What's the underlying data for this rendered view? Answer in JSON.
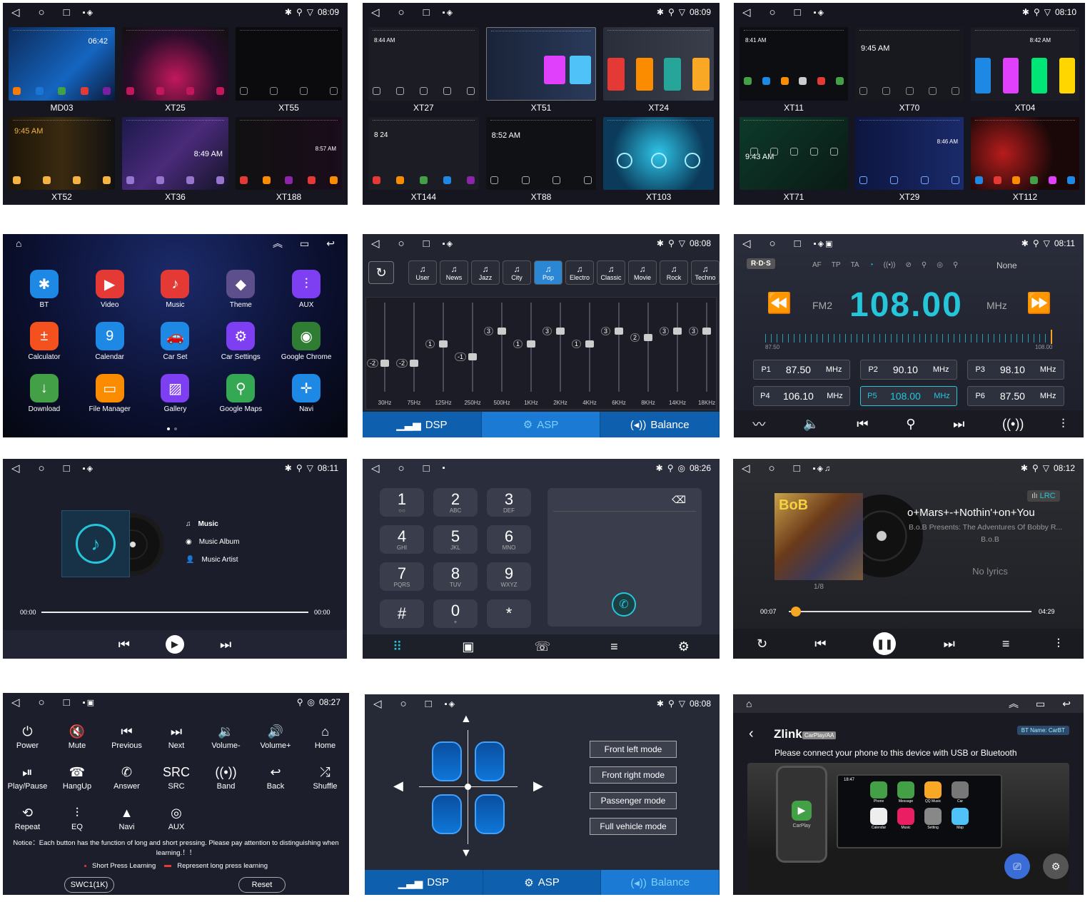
{
  "status": {
    "time_p1": "08:09",
    "time_p2": "08:09",
    "time_p3": "08:10",
    "time_p5": "08:08",
    "time_p6": "08:11",
    "time_p7": "08:11",
    "time_p8": "08:26",
    "time_p9": "08:12",
    "time_p10": "08:27",
    "time_p11": "08:08"
  },
  "themes1": [
    "MD03",
    "XT25",
    "XT55",
    "XT52",
    "XT36",
    "XT188"
  ],
  "themes2": [
    "XT27",
    "XT51",
    "XT24",
    "XT144",
    "XT88",
    "XT103"
  ],
  "themes3": [
    "XT11",
    "XT70",
    "XT04",
    "XT71",
    "XT29",
    "XT112"
  ],
  "theme_clock": {
    "md03": "06:42",
    "xt52": "9:45 AM",
    "xt36": "8:49 AM",
    "xt188": "8:57 AM",
    "xt27": "8:44 AM",
    "xt144": "8 24",
    "xt88": "8:52 AM",
    "xt11": "8:41 AM",
    "xt70": "9:45 AM",
    "xt04": "8:42 AM",
    "xt71": "9:43 AM",
    "xt29": "8:46 AM"
  },
  "launcher": {
    "apps": [
      {
        "label": "BT",
        "icon": "bluetooth-icon",
        "color": "#1e88e5",
        "glyph": "✱"
      },
      {
        "label": "Video",
        "icon": "video-icon",
        "color": "#e53935",
        "glyph": "▶"
      },
      {
        "label": "Music",
        "icon": "music-icon",
        "color": "#e53935",
        "glyph": "♪"
      },
      {
        "label": "Theme",
        "icon": "theme-icon",
        "color": "#5d4e8c",
        "glyph": "◆"
      },
      {
        "label": "AUX",
        "icon": "aux-icon",
        "color": "#7e3ff2",
        "glyph": "⫶"
      },
      {
        "label": "Calculator",
        "icon": "calculator-icon",
        "color": "#f4511e",
        "glyph": "±"
      },
      {
        "label": "Calendar",
        "icon": "calendar-icon",
        "color": "#1e88e5",
        "glyph": "9"
      },
      {
        "label": "Car Set",
        "icon": "car-icon",
        "color": "#1e88e5",
        "glyph": "🚗"
      },
      {
        "label": "Car Settings",
        "icon": "gear-icon",
        "color": "#7e3ff2",
        "glyph": "⚙"
      },
      {
        "label": "Google Chrome",
        "icon": "chrome-icon",
        "color": "#2e7d32",
        "glyph": "◉"
      },
      {
        "label": "Download",
        "icon": "download-icon",
        "color": "#43a047",
        "glyph": "↓"
      },
      {
        "label": "File Manager",
        "icon": "folder-icon",
        "color": "#fb8c00",
        "glyph": "▭"
      },
      {
        "label": "Gallery",
        "icon": "gallery-icon",
        "color": "#7e3ff2",
        "glyph": "▨"
      },
      {
        "label": "Google Maps",
        "icon": "maps-icon",
        "color": "#34a853",
        "glyph": "⚲"
      },
      {
        "label": "Navi",
        "icon": "navi-icon",
        "color": "#1e88e5",
        "glyph": "✛"
      }
    ]
  },
  "eq": {
    "presets": [
      "User",
      "News",
      "Jazz",
      "City",
      "Pop",
      "Electro",
      "Classic",
      "Movie",
      "Rock",
      "Techno"
    ],
    "active_preset": "Pop",
    "bands": [
      "30Hz",
      "75Hz",
      "125Hz",
      "250Hz",
      "500Hz",
      "1KHz",
      "2KHz",
      "4KHz",
      "6KHz",
      "8KHz",
      "14KHz",
      "18KHz"
    ],
    "levels": [
      -2,
      -2,
      1,
      -1,
      3,
      1,
      3,
      1,
      3,
      2,
      3,
      3
    ],
    "level_labels": [
      "-2",
      "-2",
      "1",
      "-1",
      "3",
      "1",
      "3",
      "1",
      "3",
      "2",
      "3",
      "3"
    ],
    "tabs": [
      "DSP",
      "ASP",
      "Balance"
    ]
  },
  "radio": {
    "logo": "R·D·S",
    "flags": [
      "AF",
      "TP",
      "TA"
    ],
    "pty": "None",
    "band": "FM2",
    "freq": "108.00",
    "unit": "MHz",
    "min": "87.50",
    "max": "108.00",
    "presets": [
      {
        "id": "P1",
        "freq": "87.50",
        "unit": "MHz"
      },
      {
        "id": "P2",
        "freq": "90.10",
        "unit": "MHz"
      },
      {
        "id": "P3",
        "freq": "98.10",
        "unit": "MHz"
      },
      {
        "id": "P4",
        "freq": "106.10",
        "unit": "MHz"
      },
      {
        "id": "P5",
        "freq": "108.00",
        "unit": "MHz"
      },
      {
        "id": "P6",
        "freq": "87.50",
        "unit": "MHz"
      }
    ]
  },
  "btmusic": {
    "music": "Music",
    "album": "Music Album",
    "artist": "Music Artist",
    "elapsed": "00:00",
    "total": "00:00"
  },
  "dialer": {
    "keys": [
      {
        "d": "1",
        "s": "○○"
      },
      {
        "d": "2",
        "s": "ABC"
      },
      {
        "d": "3",
        "s": "DEF"
      },
      {
        "d": "4",
        "s": "GHI"
      },
      {
        "d": "5",
        "s": "JKL"
      },
      {
        "d": "6",
        "s": "MNO"
      },
      {
        "d": "7",
        "s": "PQRS"
      },
      {
        "d": "8",
        "s": "TUV"
      },
      {
        "d": "9",
        "s": "WXYZ"
      },
      {
        "d": "#",
        "s": ""
      },
      {
        "d": "0",
        "s": "+"
      },
      {
        "d": "*",
        "s": ""
      }
    ]
  },
  "player": {
    "lrc": "LRC",
    "title": "o+Mars+-+Nothin'+on+You",
    "album": "B.o.B Presents: The Adventures Of Bobby R...",
    "artist": "B.o.B",
    "no_lyrics": "No lyrics",
    "track": "1/8",
    "elapsed": "00:07",
    "total": "04:29",
    "progress": 0.03
  },
  "swc": {
    "buttons": [
      {
        "label": "Power",
        "glyph": "⏻",
        "icon": "power-icon"
      },
      {
        "label": "Mute",
        "glyph": "🔇",
        "icon": "mute-icon"
      },
      {
        "label": "Previous",
        "glyph": "⏮",
        "icon": "previous-icon"
      },
      {
        "label": "Next",
        "glyph": "⏭",
        "icon": "next-icon"
      },
      {
        "label": "Volume-",
        "glyph": "🔉",
        "icon": "volume-down-icon"
      },
      {
        "label": "Volume+",
        "glyph": "🔊",
        "icon": "volume-up-icon"
      },
      {
        "label": "Home",
        "glyph": "⌂",
        "icon": "home-icon"
      },
      {
        "label": "Play/Pause",
        "glyph": "⏯",
        "icon": "play-pause-icon"
      },
      {
        "label": "HangUp",
        "glyph": "☎",
        "icon": "hangup-icon"
      },
      {
        "label": "Answer",
        "glyph": "✆",
        "icon": "answer-icon"
      },
      {
        "label": "SRC",
        "glyph": "SRC",
        "icon": "src-icon"
      },
      {
        "label": "Band",
        "glyph": "((•))",
        "icon": "band-icon"
      },
      {
        "label": "Back",
        "glyph": "↩",
        "icon": "back-icon"
      },
      {
        "label": "Shuffle",
        "glyph": "⤮",
        "icon": "shuffle-icon"
      },
      {
        "label": "Repeat",
        "glyph": "⟲",
        "icon": "repeat-icon"
      },
      {
        "label": "EQ",
        "glyph": "⫶",
        "icon": "eq-icon"
      },
      {
        "label": "Navi",
        "glyph": "▲",
        "icon": "navi-icon"
      },
      {
        "label": "AUX",
        "glyph": "◎",
        "icon": "aux-icon"
      }
    ],
    "notice": "Notice：Each button has the function of long and short pressing. Please pay attention to distinguishing when learning.！！",
    "short": "Short Press Learning",
    "long": "Represent long press learning",
    "swc1": "SWC1(1K)",
    "reset": "Reset"
  },
  "balance": {
    "modes": [
      "Front left mode",
      "Front right mode",
      "Passenger mode",
      "Full vehicle mode"
    ],
    "tabs": [
      "DSP",
      "ASP",
      "Balance"
    ]
  },
  "carplay": {
    "brand": "Zlink",
    "badge": "CarPlay/AA",
    "bt_label": "BT Name:",
    "bt_name": "CarBT",
    "message": "Please connect your phone to this device with USB or Bluetooth",
    "phone_app": "CarPlay",
    "apps": [
      "Phone",
      "Message",
      "QQ Music",
      "Car",
      "Calendar",
      "Music",
      "Setting",
      "Map"
    ],
    "time": "18:47"
  }
}
